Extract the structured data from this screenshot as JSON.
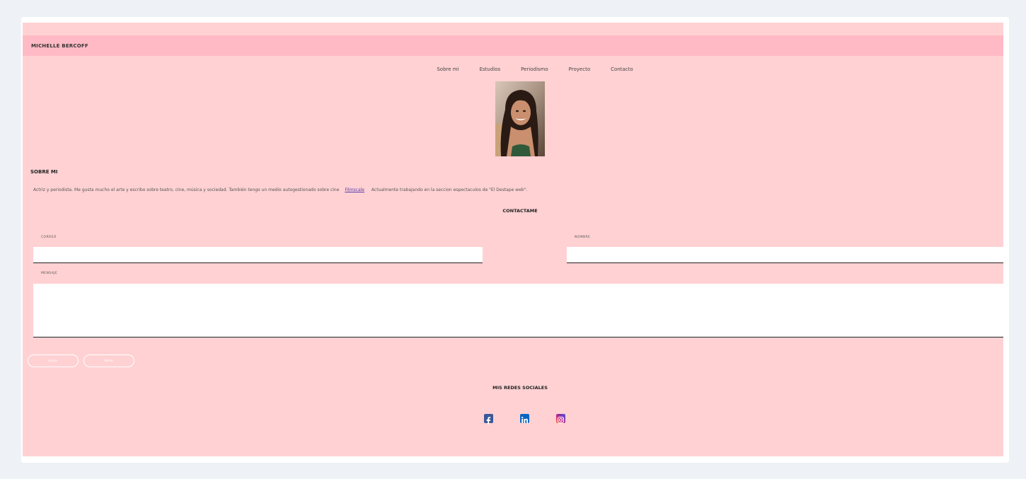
{
  "header": {
    "brand": "MICHELLE BERCOFF"
  },
  "nav": {
    "items": [
      {
        "label": "Sobre mi"
      },
      {
        "label": "Estudios"
      },
      {
        "label": "Periodismo"
      },
      {
        "label": "Proyecto"
      },
      {
        "label": "Contacto"
      }
    ]
  },
  "about": {
    "heading": "SOBRE MI",
    "text_before_link": "Actriz y periodista. Me gusta mucho el arte y escribo sobre teatro, cine, música y sociedad. También tengo un medio autogestionado sobre cine",
    "link_label": "Filmscale",
    "text_after_link": "Actualmente trabajando en la seccion espectaculos de \"El Destape web\"."
  },
  "contact": {
    "heading": "CONTACTAME",
    "email_label": "CORREO",
    "name_label": "NOMBRE",
    "message_label": "MENSAJE",
    "submit_label": "Enviar",
    "reset_label": "Borrar"
  },
  "social": {
    "heading": "MIS REDES SOCIALES",
    "icons": [
      "facebook-icon",
      "linkedin-icon",
      "instagram-icon"
    ]
  },
  "colors": {
    "page_background": "#ffd1d3",
    "header_bar": "#ffbac5",
    "outer_background": "#eef2f6",
    "facebook": "#3b5998",
    "linkedin": "#0a66c2"
  }
}
